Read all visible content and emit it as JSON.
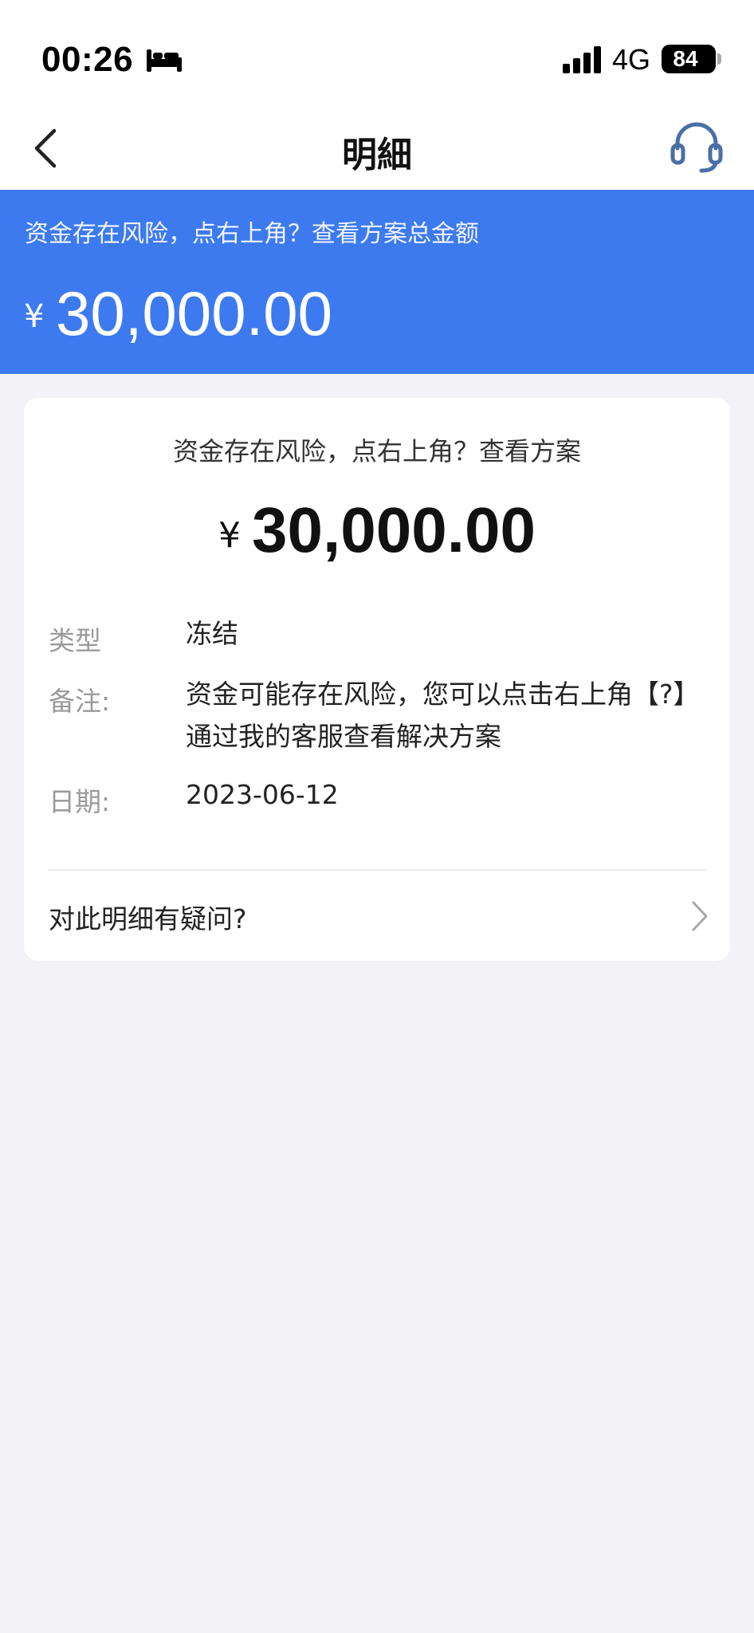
{
  "status_bar": {
    "time": "00:26",
    "network": "4G",
    "battery": "84",
    "icons": [
      "bed-icon",
      "signal-icon",
      "battery-icon"
    ]
  },
  "nav": {
    "title": "明細",
    "back_icon": "chevron-left-icon",
    "service_icon": "headset-icon",
    "accent_color": "#4a6fa5"
  },
  "banner": {
    "notice": "资金存在风险，点右上角？查看方案总金额",
    "currency": "¥",
    "amount": "30,000.00",
    "background_color": "#3d7af0"
  },
  "card": {
    "notice": "资金存在风险，点右上角？查看方案",
    "currency": "¥",
    "amount": "30,000.00",
    "details": [
      {
        "label": "类型",
        "value": "冻结"
      },
      {
        "label": "备注:",
        "value": "资金可能存在风险，您可以点击右上角【?】通过我的客服查看解决方案"
      },
      {
        "label": "日期:",
        "value": "2023-06-12"
      }
    ],
    "question": "对此明细有疑问?",
    "question_icon": "chevron-right-icon"
  }
}
